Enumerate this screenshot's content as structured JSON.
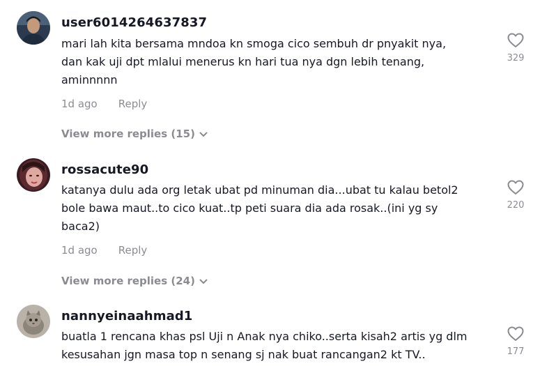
{
  "comments": [
    {
      "username": "user6014264637837",
      "text": "mari lah kita bersama mndoa kn smoga cico sembuh dr pnyakit nya,\ndan kak uji dpt mlalui menerus kn hari tua nya dgn lebih tenang,\naminnnnn",
      "time": "1d ago",
      "reply_label": "Reply",
      "view_more": "View more replies (15)",
      "likes": "329"
    },
    {
      "username": "rossacute90",
      "text": "katanya dulu ada org letak ubat pd minuman dia...ubat tu kalau betol2\nbole bawa maut..to cico kuat..tp peti suara dia ada rosak..(ini yg sy\nbaca2)",
      "time": "1d ago",
      "reply_label": "Reply",
      "view_more": "View more replies (24)",
      "likes": "220"
    },
    {
      "username": "nannyeinaahmad1",
      "text": "buatla 1 rencana khas psl Uji n Anak nya chiko..serta kisah2 artis yg dlm\nkesusahan jgn masa top n senang sj nak buat rancangan2 kt TV..",
      "likes": "177"
    }
  ],
  "icons": {
    "like": "heart-outline-icon",
    "expand": "chevron-down-icon"
  },
  "colors": {
    "primary_text": "#161823",
    "secondary_text": "#8a8b91",
    "icon": "#8a8b91"
  }
}
